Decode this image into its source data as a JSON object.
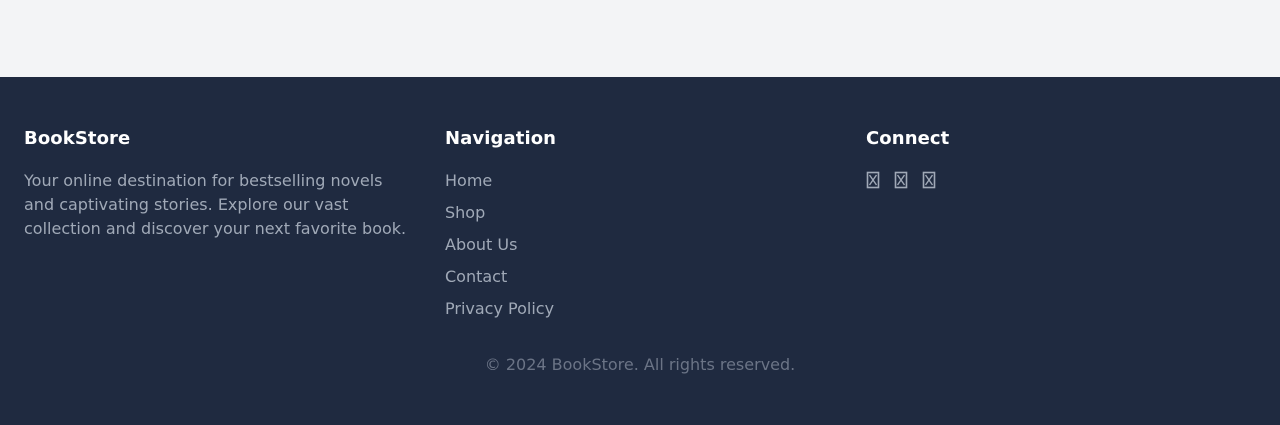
{
  "footer": {
    "brand": {
      "title": "BookStore",
      "description": "Your online destination for bestselling novels and captivating stories. Explore our vast collection and discover your next favorite book."
    },
    "navigation": {
      "title": "Navigation",
      "links": [
        {
          "label": "Home"
        },
        {
          "label": "Shop"
        },
        {
          "label": "About Us"
        },
        {
          "label": "Contact"
        },
        {
          "label": "Privacy Policy"
        }
      ]
    },
    "connect": {
      "title": "Connect",
      "icons": [
        "missing-glyph-icon",
        "missing-glyph-icon",
        "missing-glyph-icon"
      ]
    },
    "copyright": "© 2024 BookStore. All rights reserved."
  },
  "colors": {
    "page_background": "#f3f4f6",
    "footer_background": "#1f2a40",
    "heading": "#ffffff",
    "link": "#a0a9b7",
    "muted": "#6b7486"
  }
}
